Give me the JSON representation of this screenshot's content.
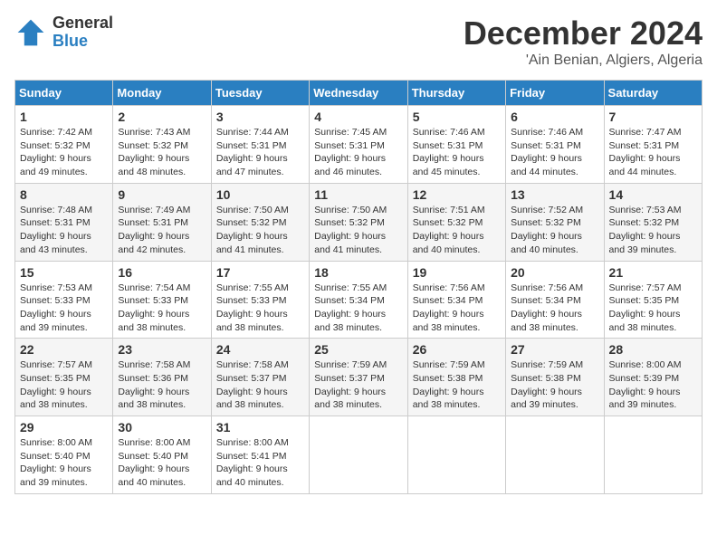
{
  "logo": {
    "general": "General",
    "blue": "Blue"
  },
  "title": "December 2024",
  "location": "'Ain Benian, Algiers, Algeria",
  "headers": [
    "Sunday",
    "Monday",
    "Tuesday",
    "Wednesday",
    "Thursday",
    "Friday",
    "Saturday"
  ],
  "weeks": [
    [
      {
        "day": "1",
        "sunrise": "7:42 AM",
        "sunset": "5:32 PM",
        "daylight": "9 hours and 49 minutes."
      },
      {
        "day": "2",
        "sunrise": "7:43 AM",
        "sunset": "5:32 PM",
        "daylight": "9 hours and 48 minutes."
      },
      {
        "day": "3",
        "sunrise": "7:44 AM",
        "sunset": "5:31 PM",
        "daylight": "9 hours and 47 minutes."
      },
      {
        "day": "4",
        "sunrise": "7:45 AM",
        "sunset": "5:31 PM",
        "daylight": "9 hours and 46 minutes."
      },
      {
        "day": "5",
        "sunrise": "7:46 AM",
        "sunset": "5:31 PM",
        "daylight": "9 hours and 45 minutes."
      },
      {
        "day": "6",
        "sunrise": "7:46 AM",
        "sunset": "5:31 PM",
        "daylight": "9 hours and 44 minutes."
      },
      {
        "day": "7",
        "sunrise": "7:47 AM",
        "sunset": "5:31 PM",
        "daylight": "9 hours and 44 minutes."
      }
    ],
    [
      {
        "day": "8",
        "sunrise": "7:48 AM",
        "sunset": "5:31 PM",
        "daylight": "9 hours and 43 minutes."
      },
      {
        "day": "9",
        "sunrise": "7:49 AM",
        "sunset": "5:31 PM",
        "daylight": "9 hours and 42 minutes."
      },
      {
        "day": "10",
        "sunrise": "7:50 AM",
        "sunset": "5:32 PM",
        "daylight": "9 hours and 41 minutes."
      },
      {
        "day": "11",
        "sunrise": "7:50 AM",
        "sunset": "5:32 PM",
        "daylight": "9 hours and 41 minutes."
      },
      {
        "day": "12",
        "sunrise": "7:51 AM",
        "sunset": "5:32 PM",
        "daylight": "9 hours and 40 minutes."
      },
      {
        "day": "13",
        "sunrise": "7:52 AM",
        "sunset": "5:32 PM",
        "daylight": "9 hours and 40 minutes."
      },
      {
        "day": "14",
        "sunrise": "7:53 AM",
        "sunset": "5:32 PM",
        "daylight": "9 hours and 39 minutes."
      }
    ],
    [
      {
        "day": "15",
        "sunrise": "7:53 AM",
        "sunset": "5:33 PM",
        "daylight": "9 hours and 39 minutes."
      },
      {
        "day": "16",
        "sunrise": "7:54 AM",
        "sunset": "5:33 PM",
        "daylight": "9 hours and 38 minutes."
      },
      {
        "day": "17",
        "sunrise": "7:55 AM",
        "sunset": "5:33 PM",
        "daylight": "9 hours and 38 minutes."
      },
      {
        "day": "18",
        "sunrise": "7:55 AM",
        "sunset": "5:34 PM",
        "daylight": "9 hours and 38 minutes."
      },
      {
        "day": "19",
        "sunrise": "7:56 AM",
        "sunset": "5:34 PM",
        "daylight": "9 hours and 38 minutes."
      },
      {
        "day": "20",
        "sunrise": "7:56 AM",
        "sunset": "5:34 PM",
        "daylight": "9 hours and 38 minutes."
      },
      {
        "day": "21",
        "sunrise": "7:57 AM",
        "sunset": "5:35 PM",
        "daylight": "9 hours and 38 minutes."
      }
    ],
    [
      {
        "day": "22",
        "sunrise": "7:57 AM",
        "sunset": "5:35 PM",
        "daylight": "9 hours and 38 minutes."
      },
      {
        "day": "23",
        "sunrise": "7:58 AM",
        "sunset": "5:36 PM",
        "daylight": "9 hours and 38 minutes."
      },
      {
        "day": "24",
        "sunrise": "7:58 AM",
        "sunset": "5:37 PM",
        "daylight": "9 hours and 38 minutes."
      },
      {
        "day": "25",
        "sunrise": "7:59 AM",
        "sunset": "5:37 PM",
        "daylight": "9 hours and 38 minutes."
      },
      {
        "day": "26",
        "sunrise": "7:59 AM",
        "sunset": "5:38 PM",
        "daylight": "9 hours and 38 minutes."
      },
      {
        "day": "27",
        "sunrise": "7:59 AM",
        "sunset": "5:38 PM",
        "daylight": "9 hours and 39 minutes."
      },
      {
        "day": "28",
        "sunrise": "8:00 AM",
        "sunset": "5:39 PM",
        "daylight": "9 hours and 39 minutes."
      }
    ],
    [
      {
        "day": "29",
        "sunrise": "8:00 AM",
        "sunset": "5:40 PM",
        "daylight": "9 hours and 39 minutes."
      },
      {
        "day": "30",
        "sunrise": "8:00 AM",
        "sunset": "5:40 PM",
        "daylight": "9 hours and 40 minutes."
      },
      {
        "day": "31",
        "sunrise": "8:00 AM",
        "sunset": "5:41 PM",
        "daylight": "9 hours and 40 minutes."
      },
      null,
      null,
      null,
      null
    ]
  ]
}
